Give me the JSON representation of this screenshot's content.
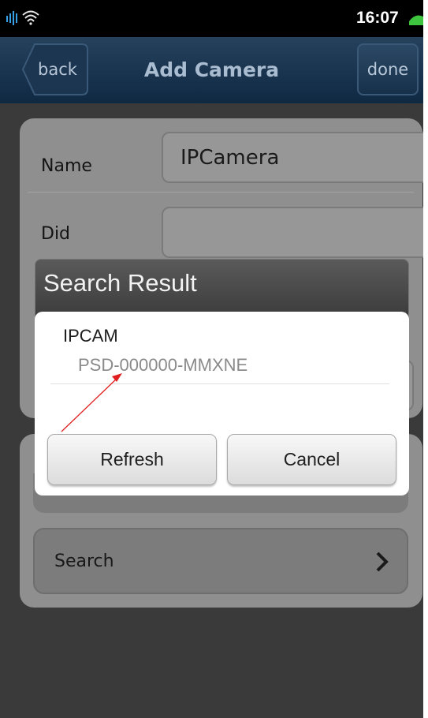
{
  "status_bar": {
    "time": "16:07",
    "icons": [
      "signal-icon",
      "wifi-icon",
      "battery-icon"
    ]
  },
  "navbar": {
    "back_label": "back",
    "title": "Add Camera",
    "done_label": "done"
  },
  "form": {
    "name_label": "Name",
    "name_value": "IPCamera",
    "did_label": "Did",
    "did_value": ""
  },
  "search_row": {
    "label": "Search"
  },
  "dialog": {
    "title": "Search Result",
    "results": [
      {
        "name": "IPCAM",
        "id": "PSD-000000-MMXNE"
      }
    ],
    "refresh_label": "Refresh",
    "cancel_label": "Cancel"
  },
  "colors": {
    "navbar": "#17314b",
    "annotation_arrow": "#e02020"
  }
}
